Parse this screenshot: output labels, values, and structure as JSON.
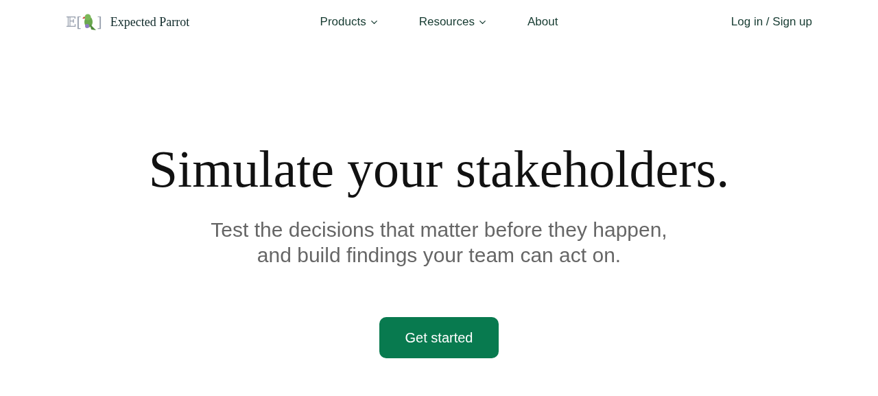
{
  "header": {
    "logo": {
      "left": "𝔼[",
      "right": "]",
      "name": "Expected Parrot"
    },
    "nav": [
      {
        "label": "Products",
        "kind": "dropdown"
      },
      {
        "label": "Resources",
        "kind": "dropdown"
      },
      {
        "label": "About",
        "kind": "link"
      }
    ],
    "login": "Log in / Sign up"
  },
  "hero": {
    "title": "Simulate your stakeholders.",
    "subtitle": [
      "Test the decisions that matter before they happen,",
      "and build findings your team can act on."
    ],
    "button": "Get started"
  }
}
